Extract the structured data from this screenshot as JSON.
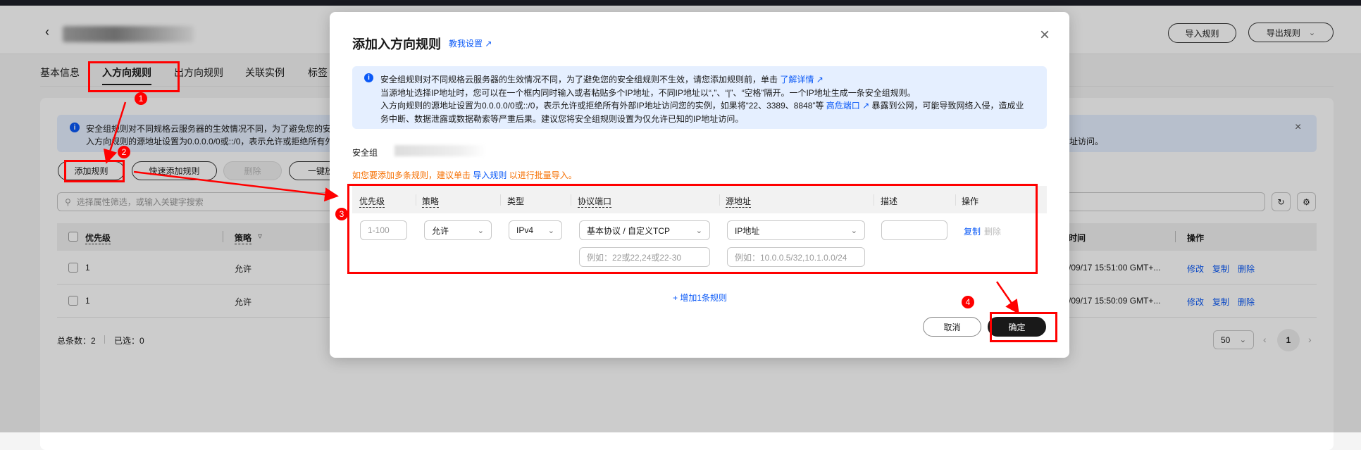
{
  "page": {
    "header": {
      "import_label": "导入规则",
      "export_label": "导出规则"
    },
    "tabs": [
      "基本信息",
      "入方向规则",
      "出方向规则",
      "关联实例",
      "标签"
    ],
    "alert": {
      "line1": "安全组规则对不同规格云服务器的生效情况不同，为了避免您的安",
      "line2": "入方向规则的源地址设置为0.0.0.0/0或::/0，表示允许或拒绝所有外",
      "line2_tail": "址访问。"
    },
    "toolbar": {
      "add": "添加规则",
      "quick_add": "快速添加规则",
      "delete": "删除",
      "one_click": "一键放"
    },
    "search_placeholder": "选择属性筛选，或输入关键字搜索",
    "table": {
      "headers": {
        "priority": "优先级",
        "policy": "策略",
        "time": "时间",
        "actions": "操作"
      },
      "rows": [
        {
          "priority": "1",
          "policy": "允许",
          "time": "/09/17 15:51:00 GMT+...",
          "edit": "修改",
          "copy": "复制",
          "delete": "删除"
        },
        {
          "priority": "1",
          "policy": "允许",
          "time": "/09/17 15:50:09 GMT+...",
          "edit": "修改",
          "copy": "复制",
          "delete": "删除"
        }
      ]
    },
    "footer": {
      "total": "总条数：2",
      "selected": "已选：0",
      "page_size": "50",
      "current_page": "1"
    }
  },
  "modal": {
    "title": "添加入方向规则",
    "help_link": "教我设置",
    "info": {
      "line1": "安全组规则对不同规格云服务器的生效情况不同，为了避免您的安全组规则不生效，请您添加规则前，单击",
      "line1_link": "了解详情",
      "line2": "当源地址选择IP地址时，您可以在一个框内同时输入或者粘贴多个IP地址，不同IP地址以“,”、“|”、“空格”隔开。一个IP地址生成一条安全组规则。",
      "line3a": "入方向规则的源地址设置为0.0.0.0/0或::/0，表示允许或拒绝所有外部IP地址访问您的实例，如果将“22、3389、8848”等",
      "line3_link": "高危端口",
      "line3b": "暴露到公网，可能导致网络入侵，造成业",
      "line4": "务中断、数据泄露或数据勒索等严重后果。建议您将安全组规则设置为仅允许已知的IP地址访问。"
    },
    "sg_label": "安全组",
    "hint": {
      "before": "如您要添加多条规则，建议单击",
      "link": "导入规则",
      "after": "以进行批量导入。"
    },
    "columns": [
      "优先级",
      "策略",
      "类型",
      "协议端口",
      "源地址",
      "描述",
      "操作"
    ],
    "row": {
      "priority_placeholder": "1-100",
      "policy": "允许",
      "type": "IPv4",
      "protocol": "基本协议 / 自定义TCP",
      "source": "IP地址",
      "port_placeholder": "例如：22或22,24或22-30",
      "source_placeholder": "例如：10.0.0.5/32,10.1.0.0/24",
      "copy": "复制",
      "delete": "删除"
    },
    "add_row": "+ 增加1条规则",
    "cancel": "取消",
    "confirm": "确定"
  },
  "annotations": [
    "1",
    "2",
    "3",
    "4"
  ],
  "colors": {
    "link": "#0a59f7",
    "warning": "#f66f00",
    "annotation": "#ff0000",
    "primary_button": "#191919"
  }
}
